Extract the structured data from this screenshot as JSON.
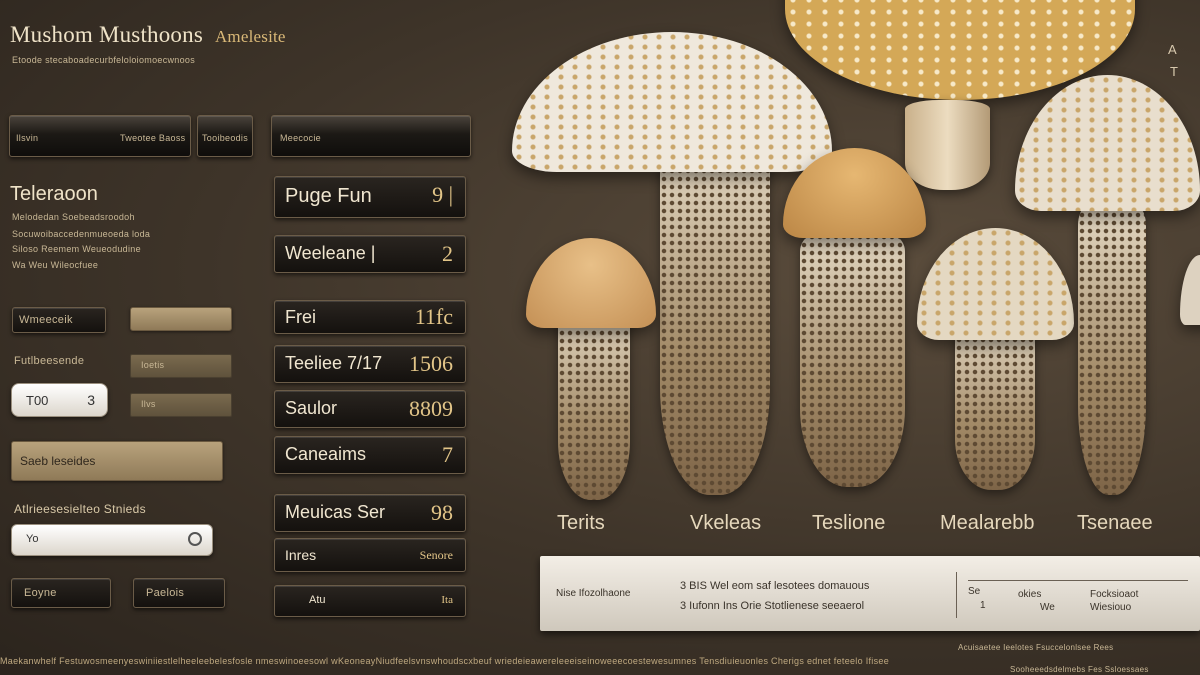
{
  "header": {
    "title": "Mushom Musthoons",
    "title_suffix": "Amelesite",
    "subtitle": "Etoode stecaboadecurbfeloloiomoecwnoos"
  },
  "toolbar": {
    "field1_label": "Ilsvin",
    "field1_value": "Tweotee Baoss",
    "field2_label": "Tooibeodis",
    "field3_label": "Meecocie"
  },
  "section": {
    "heading": "Teleraoon",
    "lines": [
      "Melodedan Soebeadsroodoh",
      "Socuwoibaccedenmueoeda loda",
      "Siloso Reemem Weueodudine",
      "Wa Weu Wileocfuee"
    ]
  },
  "left_controls": {
    "tag_button": "Wmeeceik",
    "section_label": "Futlbeesende",
    "stepper_value": "T00",
    "stepper_end": "3",
    "khaki1": "Ioetis",
    "khaki2": "Ilvs",
    "tan_button": "Saeb leseides",
    "search_label": "Atlrieesesielteo Stnieds",
    "search_value": "Yo",
    "btn_left": "Eoyne",
    "btn_right": "Paelois"
  },
  "rows": [
    {
      "label": "Puge Fun",
      "value": "9 |"
    },
    {
      "label": "Weeleane |",
      "value": "2"
    },
    {
      "label": "Frei",
      "value": "11fc"
    },
    {
      "label": "Teeliee 7/17",
      "value": "1506"
    },
    {
      "label": "Saulor",
      "value": "8809"
    },
    {
      "label": "Caneaims",
      "value": "7"
    },
    {
      "label": "Meuicas Ser",
      "value": "98"
    },
    {
      "label": "Inres",
      "value": "Senore"
    },
    {
      "label": "Atu",
      "value": "Ita"
    }
  ],
  "mushrooms": {
    "labels": [
      "Terits",
      "Vkeleas",
      "Teslione",
      "Mealarebb",
      "Tsenaee"
    ],
    "top_right_a": "A",
    "top_right_b": "T"
  },
  "info_panel": {
    "line1_left": "Nise Ifozolhaone",
    "line1_mid": "3 BIS  Wel eom saf lesotees domauous",
    "line2_mid": "3 Iufonn Ins Orie Stotlienese seeaerol",
    "right_col1_a": "Se",
    "right_col1_b": "1",
    "right_col2_a": "okies",
    "right_col2_b": "We",
    "right_col3_a": "Focksioaot",
    "right_col3_b": "Wiesiouo"
  },
  "footer": {
    "text": "Maekanwhelf Festuwosmeenyeswiniiestlelheeleebelesfosle nmeswinoeesowl wKeoneayNiudfeelsvnswhoudscxbeuf wriedeieawereleeeiseinoweeecoestewesumnes Tensdiuieuonles Cherigs ednet feteelo Ifisee",
    "right_top": "Acuisaetee Ieelotes Fsuccelonlsee Rees",
    "right_bottom": "Sooheeedsdelmebs Fes Ssloessaes"
  }
}
